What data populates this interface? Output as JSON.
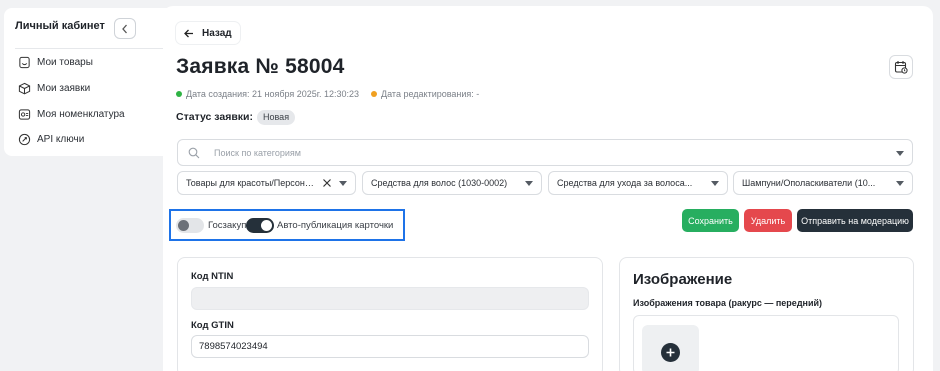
{
  "sidebar": {
    "title": "Личный кабинет",
    "items": [
      {
        "label": "Мои товары",
        "icon": "product-icon"
      },
      {
        "label": "Мои заявки",
        "icon": "box-icon"
      },
      {
        "label": "Моя номенклатура",
        "icon": "catalog-icon"
      },
      {
        "label": "API ключи",
        "icon": "key-icon"
      }
    ]
  },
  "header": {
    "back_label": "Назад",
    "title": "Заявка № 58004",
    "created": "Дата создания: 21 ноября 2025г. 12:30:23",
    "edited": "Дата редактирования: -",
    "status_label": "Статус заявки:",
    "status_value": "Новая"
  },
  "filters": {
    "search_placeholder": "Поиск по категориям",
    "selects": [
      "Товары для красоты/Персонал...",
      "Средства для волос (1030-0002)",
      "Средства для ухода за волоса...",
      "Шампуни/Ополаскиватели (10..."
    ]
  },
  "toggles": {
    "goszakup_label": "Госзакуп",
    "goszakup_on": false,
    "autopub_label": "Авто-публикация карточки",
    "autopub_on": true
  },
  "actions": {
    "save": "Сохранить",
    "delete": "Удалить",
    "moderate": "Отправить на модерацию"
  },
  "form": {
    "ntin_label": "Код NTIN",
    "ntin_value": "",
    "gtin_label": "Код GTIN",
    "gtin_value": "7898574023494"
  },
  "image_panel": {
    "title": "Изображение",
    "subtitle": "Изображения товара (ракурс — передний)"
  },
  "colors": {
    "accent_dark": "#25303a",
    "save_green": "#27ae60",
    "delete_red": "#e5484d",
    "highlight_blue": "#1e73e8",
    "created_dot": "#2fb344",
    "edited_dot": "#f0a020"
  }
}
